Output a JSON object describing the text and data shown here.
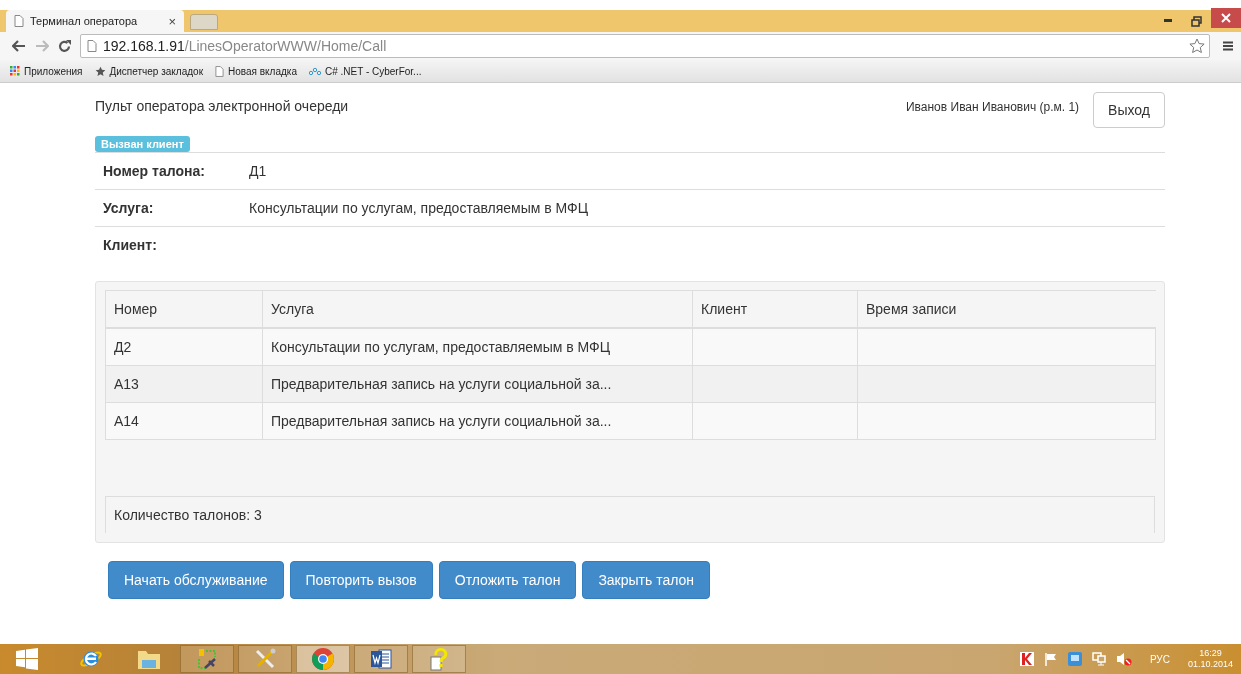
{
  "browser": {
    "tab_title": "Терминал оператора",
    "tab_close": "×",
    "url_host": "192.168.1.91",
    "url_path": "/LinesOperatorWWW/Home/Call",
    "bookmarks": [
      {
        "kind": "apps",
        "label": "Приложения"
      },
      {
        "kind": "star",
        "label": "Диспетчер закладок"
      },
      {
        "kind": "page",
        "label": "Новая вкладка"
      },
      {
        "kind": "link",
        "label": "C# .NET - CyberFor..."
      }
    ]
  },
  "page": {
    "title": "Пульт оператора электронной очереди",
    "user": "Иванов Иван Иванович (р.м. 1)",
    "logout": "Выход",
    "status_badge": "Вызван клиент",
    "fields": [
      {
        "label": "Номер талона:",
        "value": "Д1"
      },
      {
        "label": "Услуга:",
        "value": "Консультации по услугам, предоставляемым в МФЦ"
      },
      {
        "label": "Клиент:"
      }
    ],
    "table": {
      "columns": [
        "Номер",
        "Услуга",
        "Клиент",
        "Время записи"
      ],
      "rows": [
        [
          "Д2",
          "Консультации по услугам, предоставляемым в МФЦ",
          "",
          ""
        ],
        [
          "А13",
          "Предварительная запись на услуги социальной за...",
          "",
          ""
        ],
        [
          "А14",
          "Предварительная запись на услуги социальной за...",
          "",
          ""
        ]
      ],
      "footer": "Количество талонов: 3"
    },
    "buttons": [
      "Начать обслуживание",
      "Повторить вызов",
      "Отложить талон",
      "Закрыть талон"
    ]
  },
  "taskbar": {
    "apps": [
      {
        "kind": "ie",
        "selected": false
      },
      {
        "kind": "folder",
        "selected": false
      },
      {
        "kind": "network",
        "selected": false
      },
      {
        "kind": "tools",
        "selected": false
      },
      {
        "kind": "chrome",
        "selected": true
      },
      {
        "kind": "word",
        "selected": false
      },
      {
        "kind": "help",
        "selected": false
      }
    ],
    "language": "РУС",
    "time": "16:29",
    "date": "01.10.2014"
  }
}
